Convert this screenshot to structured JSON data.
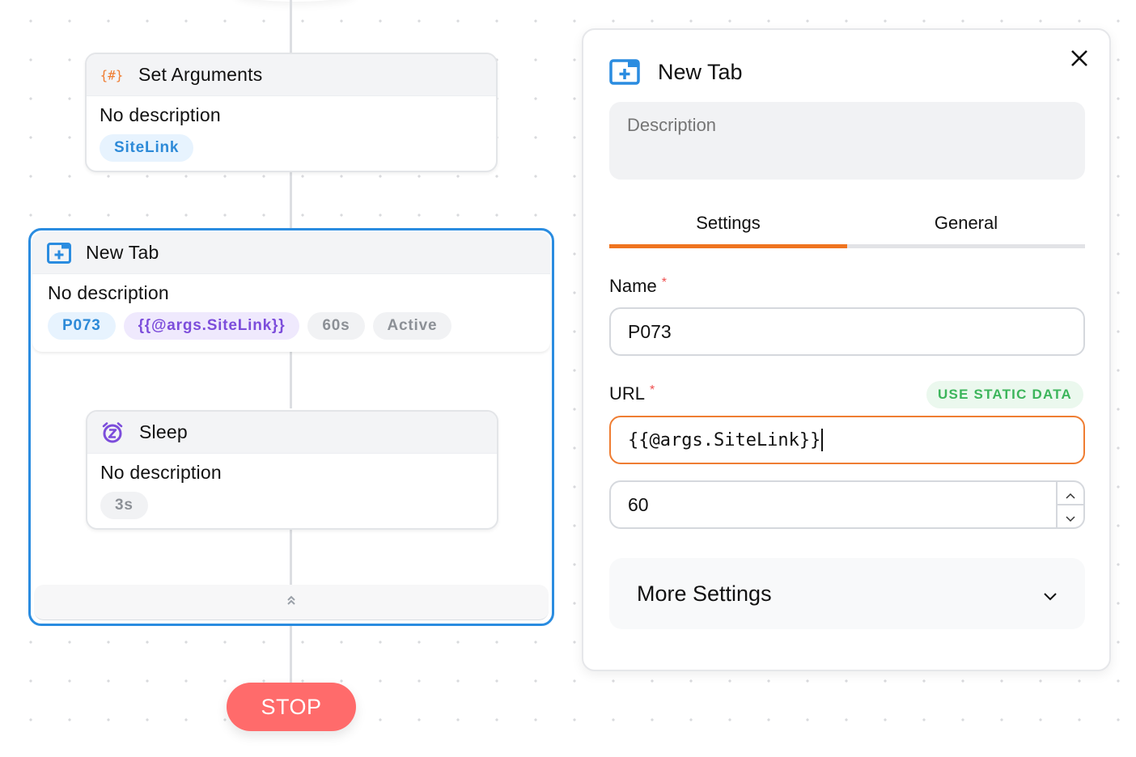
{
  "canvas": {
    "nodes": [
      {
        "id": "set-arguments",
        "icon": "braces-hash-icon",
        "title": "Set Arguments",
        "description": "No description",
        "chips": [
          {
            "label": "SiteLink",
            "style": "blue"
          }
        ]
      },
      {
        "id": "new-tab",
        "icon": "new-tab-icon",
        "title": "New Tab",
        "description": "No description",
        "chips": [
          {
            "label": "P073",
            "style": "blue"
          },
          {
            "label": "{{@args.SiteLink}}",
            "style": "purple"
          },
          {
            "label": "60s",
            "style": "gray"
          },
          {
            "label": "Active",
            "style": "gray"
          }
        ]
      },
      {
        "id": "sleep",
        "icon": "alarm-clock-z-icon",
        "title": "Sleep",
        "description": "No description",
        "chips": [
          {
            "label": "3s",
            "style": "gray"
          }
        ]
      }
    ],
    "collapse_icon": "chevrons-up-icon",
    "stop_label": "STOP"
  },
  "panel": {
    "title": "New Tab",
    "icon": "new-tab-icon",
    "close_icon": "close-icon",
    "description_placeholder": "Description",
    "description_value": "",
    "tabs": [
      {
        "label": "Settings",
        "active": true
      },
      {
        "label": "General",
        "active": false
      }
    ],
    "fields": {
      "name": {
        "label": "Name",
        "required_mark": "*",
        "value": "P073"
      },
      "url": {
        "label": "URL",
        "required_mark": "*",
        "value": "{{@args.SiteLink}}",
        "action_label": "USE STATIC DATA"
      },
      "timeout": {
        "value": "60"
      }
    },
    "more_settings_label": "More Settings"
  },
  "colors": {
    "accent_orange": "#ef7420",
    "selection_blue": "#2a8ce0",
    "stop_red": "#ff6b6b",
    "static_green": "#3cb55b",
    "required_red": "#ef4f4f"
  }
}
